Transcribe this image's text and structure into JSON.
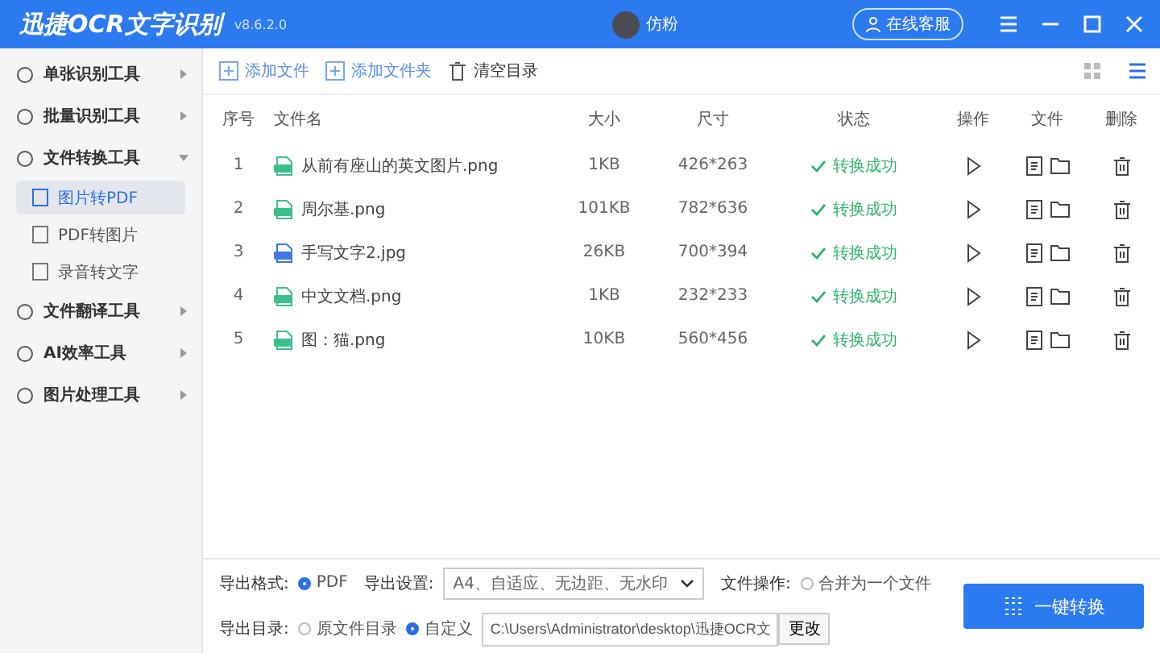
{
  "window": {
    "title": "迅捷OCR文字识别",
    "version": "v8.6.2.0",
    "user": "仿粉",
    "service_button": "在线客服"
  },
  "sidebar": {
    "items": [
      {
        "label": "单张识别工具",
        "expanded": false,
        "selected": false
      },
      {
        "label": "批量识别工具",
        "expanded": false,
        "selected": false
      },
      {
        "label": "文件转换工具",
        "expanded": true,
        "selected": false,
        "children": [
          {
            "label": "图片转PDF",
            "selected": true
          },
          {
            "label": "PDF转图片",
            "selected": false
          },
          {
            "label": "录音转文字",
            "selected": false
          }
        ]
      },
      {
        "label": "文件翻译工具",
        "expanded": false,
        "selected": false
      },
      {
        "label": "AI效率工具",
        "expanded": false,
        "selected": false
      },
      {
        "label": "图片处理工具",
        "expanded": false,
        "selected": false
      }
    ]
  },
  "toolbar": {
    "buttons": [
      {
        "kind": "add-file",
        "label": "添加文件"
      },
      {
        "kind": "add-folder",
        "label": "添加文件夹"
      },
      {
        "kind": "clear",
        "label": "清空目录"
      }
    ],
    "views": [
      {
        "kind": "grid",
        "selected": false
      },
      {
        "kind": "list",
        "selected": true
      }
    ]
  },
  "table": {
    "columns": [
      "序号",
      "文件名",
      "大小",
      "尺寸",
      "状态",
      "操作",
      "文件",
      "删除"
    ],
    "rows": [
      {
        "index": "1",
        "name": "从前有座山的英文图片.png",
        "kind": "png",
        "size": "1KB",
        "dimensions": "426*263",
        "status": "转换成功"
      },
      {
        "index": "2",
        "name": "周尔基.png",
        "kind": "png",
        "size": "101KB",
        "dimensions": "782*636",
        "status": "转换成功"
      },
      {
        "index": "3",
        "name": "手写文字2.jpg",
        "kind": "jpg",
        "size": "26KB",
        "dimensions": "700*394",
        "status": "转换成功"
      },
      {
        "index": "4",
        "name": "中文文档.png",
        "kind": "png",
        "size": "1KB",
        "dimensions": "232*233",
        "status": "转换成功"
      },
      {
        "index": "5",
        "name": "图：猫.png",
        "kind": "png",
        "size": "10KB",
        "dimensions": "560*456",
        "status": "转换成功"
      }
    ]
  },
  "export": {
    "format_label": "导出格式:",
    "formats": [
      {
        "label": "PDF",
        "selected": true
      }
    ],
    "settings_label": "导出设置:",
    "settings_value": "A4、自适应、无边距、无水印",
    "file_op_label": "文件操作:",
    "merge": {
      "label": "合并为一个文件",
      "checked": false
    },
    "dir_label": "导出目录:",
    "dirs": [
      {
        "label": "原文件目录",
        "selected": false
      },
      {
        "label": "自定义",
        "selected": true
      }
    ],
    "path": "C:\\Users\\Administrator\\desktop\\迅捷OCR文",
    "change_button": "更改",
    "convert_button": "一键转换"
  }
}
